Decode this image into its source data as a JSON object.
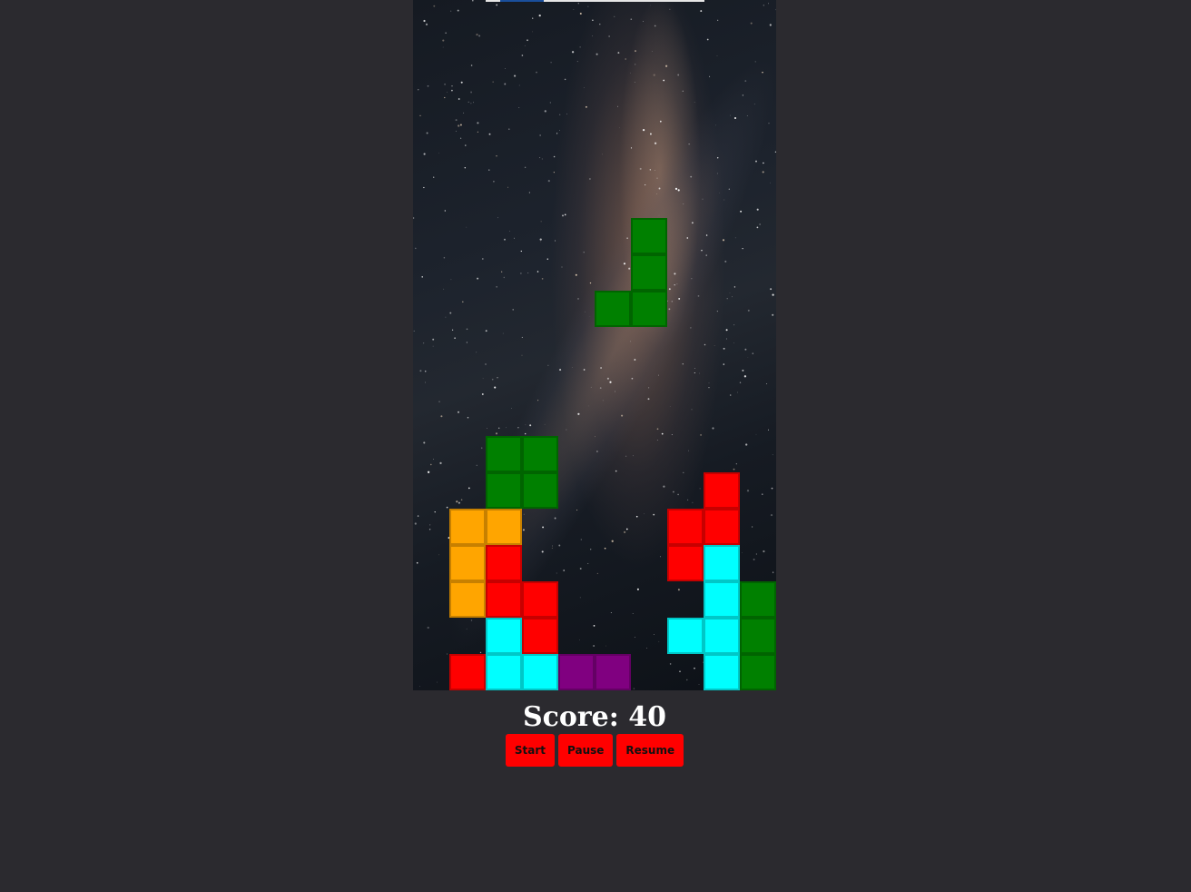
{
  "score": {
    "label": "Score: 40"
  },
  "controls": {
    "start_label": "Start",
    "pause_label": "Pause",
    "resume_label": "Resume"
  },
  "colors": {
    "page_background": "#2b2a2f",
    "button": "#ff0000",
    "green": "#008000",
    "red": "#ff0000",
    "orange": "#ffa500",
    "cyan": "#00ffff",
    "purple": "#800080"
  },
  "board": {
    "columns": 10,
    "rows": 19,
    "background": "milky-way-starfield",
    "falling_piece": {
      "color": "green",
      "cells": [
        [
          6,
          6
        ],
        [
          6,
          7
        ],
        [
          5,
          8
        ],
        [
          6,
          8
        ]
      ]
    },
    "settled_cells": [
      {
        "col": 2,
        "row": 12,
        "color": "green"
      },
      {
        "col": 3,
        "row": 12,
        "color": "green"
      },
      {
        "col": 2,
        "row": 13,
        "color": "green"
      },
      {
        "col": 3,
        "row": 13,
        "color": "green"
      },
      {
        "col": 8,
        "row": 13,
        "color": "red"
      },
      {
        "col": 1,
        "row": 14,
        "color": "orange"
      },
      {
        "col": 2,
        "row": 14,
        "color": "orange"
      },
      {
        "col": 7,
        "row": 14,
        "color": "red"
      },
      {
        "col": 8,
        "row": 14,
        "color": "red"
      },
      {
        "col": 1,
        "row": 15,
        "color": "orange"
      },
      {
        "col": 2,
        "row": 15,
        "color": "red"
      },
      {
        "col": 7,
        "row": 15,
        "color": "red"
      },
      {
        "col": 8,
        "row": 15,
        "color": "cyan"
      },
      {
        "col": 1,
        "row": 16,
        "color": "orange"
      },
      {
        "col": 2,
        "row": 16,
        "color": "red"
      },
      {
        "col": 3,
        "row": 16,
        "color": "red"
      },
      {
        "col": 8,
        "row": 16,
        "color": "cyan"
      },
      {
        "col": 9,
        "row": 16,
        "color": "green"
      },
      {
        "col": 2,
        "row": 17,
        "color": "cyan"
      },
      {
        "col": 3,
        "row": 17,
        "color": "red"
      },
      {
        "col": 7,
        "row": 17,
        "color": "cyan"
      },
      {
        "col": 8,
        "row": 17,
        "color": "cyan"
      },
      {
        "col": 9,
        "row": 17,
        "color": "green"
      },
      {
        "col": 1,
        "row": 18,
        "color": "red"
      },
      {
        "col": 2,
        "row": 18,
        "color": "cyan"
      },
      {
        "col": 3,
        "row": 18,
        "color": "cyan"
      },
      {
        "col": 4,
        "row": 18,
        "color": "purple"
      },
      {
        "col": 5,
        "row": 18,
        "color": "purple"
      },
      {
        "col": 8,
        "row": 18,
        "color": "cyan"
      },
      {
        "col": 9,
        "row": 18,
        "color": "green"
      }
    ]
  }
}
